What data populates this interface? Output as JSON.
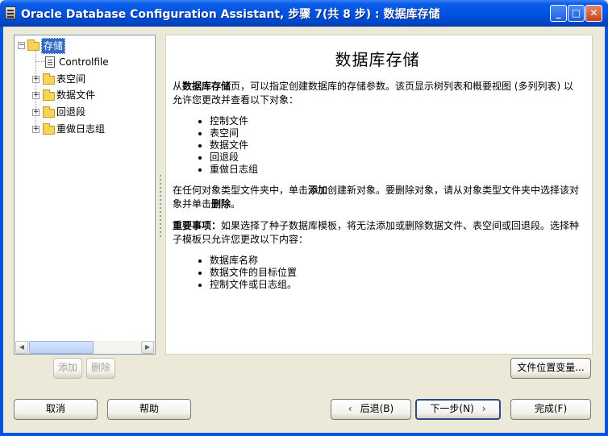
{
  "window": {
    "title": "Oracle Database Configuration Assistant, 步骤 7(共 8 步) : 数据库存储"
  },
  "tree": {
    "root_label": "存储",
    "items": [
      {
        "label": "Controlfile"
      },
      {
        "label": "表空间"
      },
      {
        "label": "数据文件"
      },
      {
        "label": "回退段"
      },
      {
        "label": "重做日志组"
      }
    ]
  },
  "content": {
    "title": "数据库存储",
    "p1_pre": "从",
    "p1_bold": "数据库存储",
    "p1_post": "页，可以指定创建数据库的存储参数。该页显示树列表和概要视图 (多列列表) 以允许您更改并查看以下对象：",
    "list1": [
      "控制文件",
      "表空间",
      "数据文件",
      "回退段",
      "重做日志组"
    ],
    "p2_a": "在任何对象类型文件夹中，单击",
    "p2_b": "添加",
    "p2_c": "创建新对象。要删除对象，请从对象类型文件夹中选择该对象并单击",
    "p2_d": "删除",
    "p2_e": "。",
    "p3_bold": "重要事项：",
    "p3_text": "如果选择了种子数据库模板，将无法添加或删除数据文件、表空间或回退段。选择种子模板只允许您更改以下内容：",
    "list2": [
      "数据库名称",
      "数据文件的目标位置",
      "控制文件或日志组。"
    ]
  },
  "buttons": {
    "add": "添加",
    "remove": "删除",
    "file_location": "文件位置变量...",
    "cancel": "取消",
    "help": "帮助",
    "back": "后退(B)",
    "next": "下一步(N)",
    "finish": "完成(F)"
  }
}
